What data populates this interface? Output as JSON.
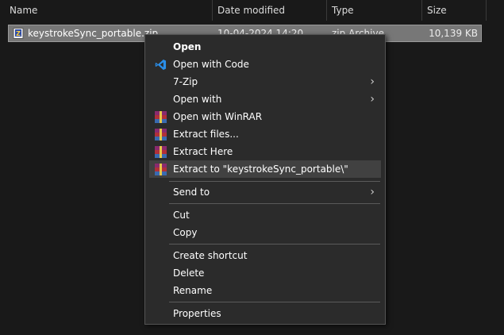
{
  "columns": {
    "name": "Name",
    "date_modified": "Date modified",
    "type": "Type",
    "size": "Size"
  },
  "file": {
    "name": "keystrokeSync_portable.zip",
    "date_modified": "10-04-2024 14:20",
    "type": "zip Archive",
    "size": "10,139 KB",
    "icon": "zip-archive-icon"
  },
  "menu": {
    "open": "Open",
    "open_with_code": "Open with Code",
    "seven_zip": "7-Zip",
    "open_with": "Open with",
    "open_with_winrar": "Open with WinRAR",
    "extract_files": "Extract files...",
    "extract_here": "Extract Here",
    "extract_to": "Extract to \"keystrokeSync_portable\\\"",
    "send_to": "Send to",
    "cut": "Cut",
    "copy": "Copy",
    "create_shortcut": "Create shortcut",
    "delete": "Delete",
    "rename": "Rename",
    "properties": "Properties"
  },
  "colors": {
    "background": "#191919",
    "menu_background": "#2b2b2b",
    "hover": "#414141",
    "vscode_blue": "#2a8ee8",
    "winrar_red": "#b0303a"
  }
}
